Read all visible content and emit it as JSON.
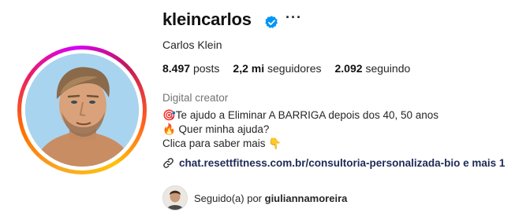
{
  "profile": {
    "username": "kleincarlos",
    "full_name": "Carlos Klein",
    "verified_icon": "verified-badge-icon",
    "more_icon": "more-options-icon",
    "more_label": "···"
  },
  "stats": {
    "posts_count": "8.497",
    "posts_label": "posts",
    "followers_count": "2,2 mi",
    "followers_label": "seguidores",
    "following_count": "2.092",
    "following_label": "seguindo"
  },
  "bio": {
    "category": "Digital creator",
    "lines": [
      "🎯Te ajudo a Eliminar A BARRIGA depois dos 40, 50 anos",
      "🔥 Quer minha ajuda?",
      "Clica para saber mais 👇"
    ],
    "link_icon": "link-icon",
    "link_text": "chat.resettfitness.com.br/consultoria-personalizada-bio e mais 1"
  },
  "followed_by": {
    "prefix": "Seguido(a) por",
    "user": "giuliannamoreira"
  },
  "colors": {
    "verified_blue": "#0095f6",
    "text_primary": "#262626",
    "text_secondary": "#737373",
    "link_text": "#1d2b56"
  }
}
